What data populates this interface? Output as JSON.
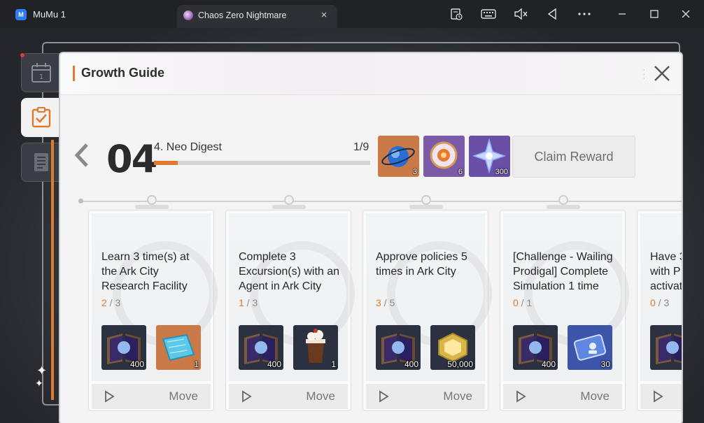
{
  "window": {
    "app_name": "MuMu 1",
    "tab_title": "Chaos Zero Nightmare",
    "tab_close": "×"
  },
  "toolbar": {
    "icons": [
      "task-icon",
      "keyboard-icon",
      "mute-icon",
      "back-icon",
      "more-icon",
      "minimize-icon",
      "maximize-icon",
      "close-icon"
    ]
  },
  "panel": {
    "title": "Growth Guide"
  },
  "chapter": {
    "number": "04",
    "name": "4. Neo Digest",
    "progress_text": "1/9",
    "progress_fraction": 0.11
  },
  "rewards": [
    {
      "icon": "orb-icon",
      "qty": "3",
      "bg": "#c97a47"
    },
    {
      "icon": "medallion-icon",
      "qty": "6",
      "bg": "#7b5aa8"
    },
    {
      "icon": "star-crystal-icon",
      "qty": "300",
      "bg": "#6a4fa6"
    }
  ],
  "claim_label": "Claim Reward",
  "missions": [
    {
      "title": "Learn 3 time(s) at the Ark City Research Facility",
      "current": "2",
      "total": "3",
      "items": [
        {
          "icon": "book-icon",
          "qty": "400",
          "bg": "#2b3140"
        },
        {
          "icon": "blueprint-icon",
          "qty": "1",
          "bg": "#c97a47"
        }
      ],
      "move_label": "Move"
    },
    {
      "title": "Complete 3 Excursion(s) with an Agent in Ark City",
      "current": "1",
      "total": "3",
      "items": [
        {
          "icon": "book-icon",
          "qty": "400",
          "bg": "#2b3140"
        },
        {
          "icon": "drink-icon",
          "qty": "1",
          "bg": "#2b3140"
        }
      ],
      "move_label": "Move"
    },
    {
      "title": "Approve policies 5 times in Ark City",
      "current": "3",
      "total": "5",
      "items": [
        {
          "icon": "book-icon",
          "qty": "400",
          "bg": "#2b3140"
        },
        {
          "icon": "gold-icon",
          "qty": "50,000",
          "bg": "#2b3140"
        }
      ],
      "move_label": "Move"
    },
    {
      "title": "[Challenge - Wailing Prodigal] Complete Simulation 1 time",
      "current": "0",
      "total": "1",
      "items": [
        {
          "icon": "book-icon",
          "qty": "400",
          "bg": "#2b3140"
        },
        {
          "icon": "ticket-icon",
          "qty": "30",
          "bg": "#3c55a8"
        }
      ],
      "move_label": "Move"
    },
    {
      "title": "Have 3 with P activat",
      "current": "0",
      "total": "3",
      "items": [
        {
          "icon": "book-icon",
          "qty": "4",
          "bg": "#2b3140"
        }
      ],
      "move_label": "Move"
    }
  ],
  "colors": {
    "accent": "#e07a2e",
    "panel_bg": "#f4f4f4"
  }
}
